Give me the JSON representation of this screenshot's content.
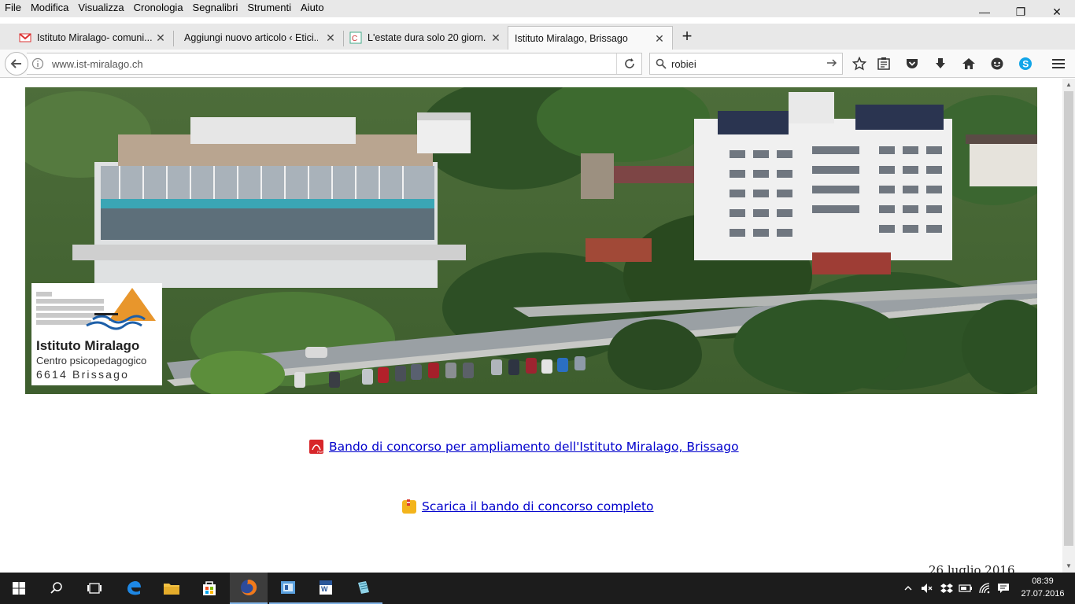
{
  "menu": [
    "File",
    "Modifica",
    "Visualizza",
    "Cronologia",
    "Segnalibri",
    "Strumenti",
    "Aiuto"
  ],
  "window_controls": {
    "minimize": "—",
    "restore": "❐",
    "close": "✕"
  },
  "tabs": [
    {
      "title": "Istituto Miralago- comuni...",
      "favicon": "gmail-icon",
      "active": false
    },
    {
      "title": "Aggiungi nuovo articolo ‹ Etici...",
      "favicon": "none",
      "active": false
    },
    {
      "title": "L'estate dura solo 20 giorn...",
      "favicon": "site-icon",
      "active": false
    },
    {
      "title": "Istituto Miralago, Brissago",
      "favicon": "none",
      "active": true
    }
  ],
  "tab_close": "✕",
  "new_tab": "+",
  "nav": {
    "url": "www.ist-miralago.ch",
    "search_value": "robiei"
  },
  "page": {
    "logo": {
      "name": "Istituto Miralago",
      "subtitle": "Centro psicopedagogico",
      "address": "6614  Brissago"
    },
    "link_pdf": "Bando di concorso per ampliamento dell'Istituto Miralago, Brissago",
    "link_zip": "Scarica il bando di concorso completo",
    "date": "26 luglio 2016"
  },
  "taskbar": {
    "clock_time": "08:39",
    "clock_date": "27.07.2016"
  },
  "colors": {
    "link": "#0000cc",
    "taskbar": "#1c1c1c",
    "logo_orange": "#e8962c",
    "logo_blue": "#1d5fa8"
  }
}
